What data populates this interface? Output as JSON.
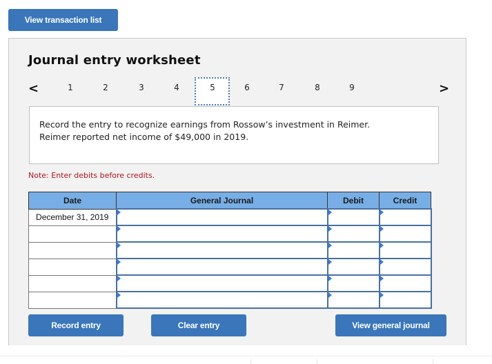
{
  "header": {
    "view_transaction_list": "View transaction list"
  },
  "worksheet": {
    "title": "Journal entry worksheet",
    "nav": {
      "prev_icon": "chevron-left-icon",
      "next_icon": "chevron-right-icon",
      "pages": [
        "1",
        "2",
        "3",
        "4",
        "5",
        "6",
        "7",
        "8",
        "9"
      ],
      "active_page": "5"
    },
    "prompt_line1": "Record the entry to recognize earnings from Rossow’s investment in Reimer.",
    "prompt_line2": "Reimer reported net income of $49,000 in 2019.",
    "note": "Note: Enter debits before credits.",
    "table": {
      "headers": {
        "date": "Date",
        "journal": "General Journal",
        "debit": "Debit",
        "credit": "Credit"
      },
      "rows": [
        {
          "date": "December 31, 2019",
          "account": "",
          "debit": "",
          "credit": ""
        },
        {
          "date": "",
          "account": "",
          "debit": "",
          "credit": ""
        },
        {
          "date": "",
          "account": "",
          "debit": "",
          "credit": ""
        },
        {
          "date": "",
          "account": "",
          "debit": "",
          "credit": ""
        },
        {
          "date": "",
          "account": "",
          "debit": "",
          "credit": ""
        },
        {
          "date": "",
          "account": "",
          "debit": "",
          "credit": ""
        }
      ]
    },
    "buttons": {
      "record_entry": "Record entry",
      "clear_entry": "Clear entry",
      "view_general_journal": "View general journal"
    }
  },
  "colors": {
    "button": "#3a76b9",
    "table_header": "#78aee6",
    "note": "#b0141c",
    "active_page_border": "#4a78b8"
  }
}
